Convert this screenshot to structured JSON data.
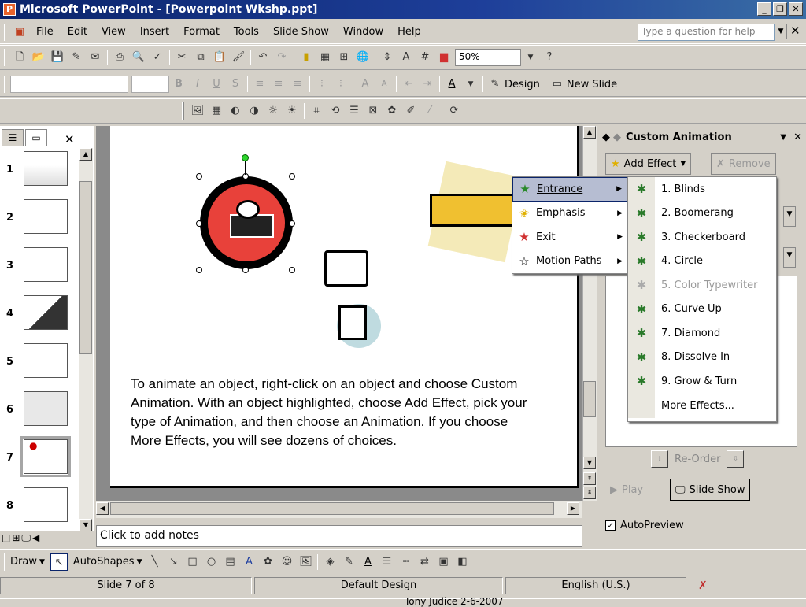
{
  "window": {
    "title": "Microsoft PowerPoint - [Powerpoint Wkshp.ppt]"
  },
  "menubar": {
    "items": [
      "File",
      "Edit",
      "View",
      "Insert",
      "Format",
      "Tools",
      "Slide Show",
      "Window",
      "Help"
    ],
    "ask_placeholder": "Type a question for help"
  },
  "toolbar": {
    "zoom": "50%",
    "design_label": "Design",
    "new_slide_label": "New Slide"
  },
  "slides_pane": {
    "numbers": [
      "1",
      "2",
      "3",
      "4",
      "5",
      "6",
      "7",
      "8"
    ],
    "selected": "7"
  },
  "slide": {
    "body_text": "To animate an object, right-click on an object and choose Custom Animation.  With an object highlighted, choose Add Effect, pick your type of Animation, and then choose an Animation.  If you choose More Effects, you will see dozens of choices."
  },
  "notes": {
    "placeholder": "Click to add notes"
  },
  "task_pane": {
    "title": "Custom Animation",
    "add_effect": "Add Effect",
    "remove": "Remove",
    "reorder": "Re-Order",
    "play": "Play",
    "slide_show": "Slide Show",
    "autopreview": "AutoPreview"
  },
  "effect_menu": {
    "items": [
      "Entrance",
      "Emphasis",
      "Exit",
      "Motion Paths"
    ]
  },
  "entrance_menu": {
    "items": [
      "1. Blinds",
      "2. Boomerang",
      "3. Checkerboard",
      "4. Circle",
      "5. Color Typewriter",
      "6. Curve Up",
      "7. Diamond",
      "8. Dissolve In",
      "9. Grow & Turn"
    ],
    "more": "More Effects..."
  },
  "drawbar": {
    "draw": "Draw",
    "autoshapes": "AutoShapes"
  },
  "status": {
    "slide": "Slide 7 of 8",
    "design": "Default Design",
    "language": "English (U.S.)"
  },
  "taskbar": {
    "text": "Tony Judice    2-6-2007"
  }
}
